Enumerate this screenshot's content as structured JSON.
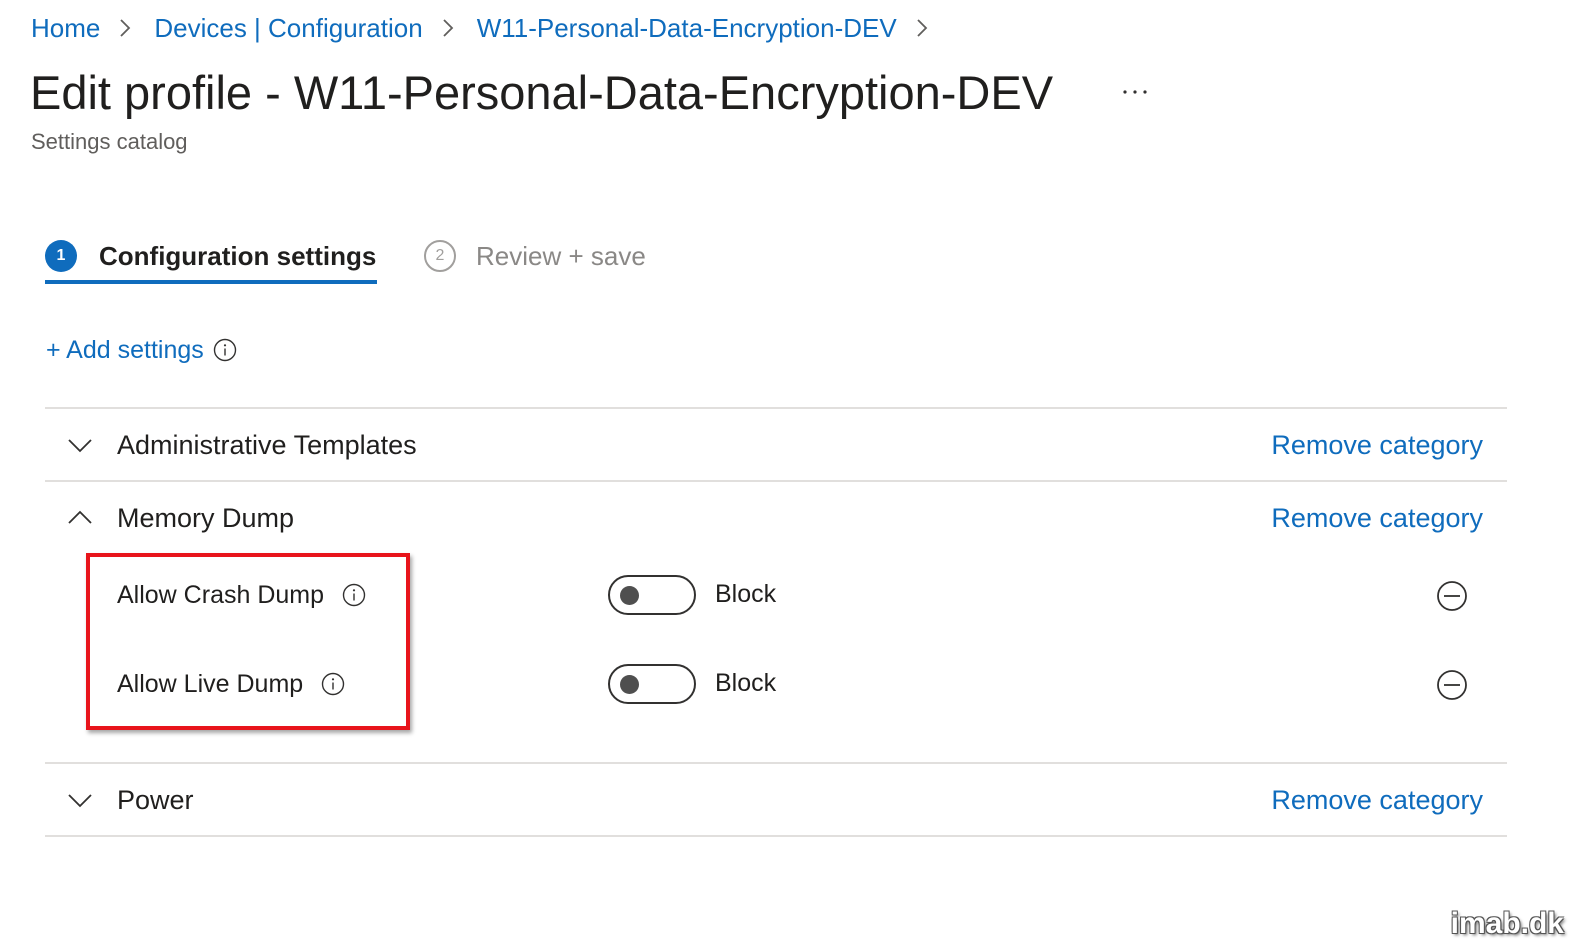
{
  "breadcrumb": {
    "items": [
      "Home",
      "Devices | Configuration",
      "W11-Personal-Data-Encryption-DEV"
    ]
  },
  "page": {
    "title": "Edit profile - W11-Personal-Data-Encryption-DEV",
    "subtitle": "Settings catalog",
    "more_icon": "ellipsis-icon"
  },
  "wizard": {
    "steps": [
      {
        "number": "1",
        "label": "Configuration settings",
        "active": true
      },
      {
        "number": "2",
        "label": "Review + save",
        "active": false
      }
    ]
  },
  "add_settings": {
    "label": "+ Add settings",
    "info_icon": "info-icon"
  },
  "categories": [
    {
      "title": "Administrative Templates",
      "expanded": false,
      "remove_label": "Remove category"
    },
    {
      "title": "Memory Dump",
      "expanded": true,
      "remove_label": "Remove category",
      "settings": [
        {
          "label": "Allow Crash Dump",
          "value": "Block",
          "toggle_on": false
        },
        {
          "label": "Allow Live Dump",
          "value": "Block",
          "toggle_on": false
        }
      ]
    },
    {
      "title": "Power",
      "expanded": false,
      "remove_label": "Remove category"
    }
  ],
  "colors": {
    "accent": "#0f6cbd",
    "highlight": "#e8141b"
  },
  "watermark": "imab.dk"
}
